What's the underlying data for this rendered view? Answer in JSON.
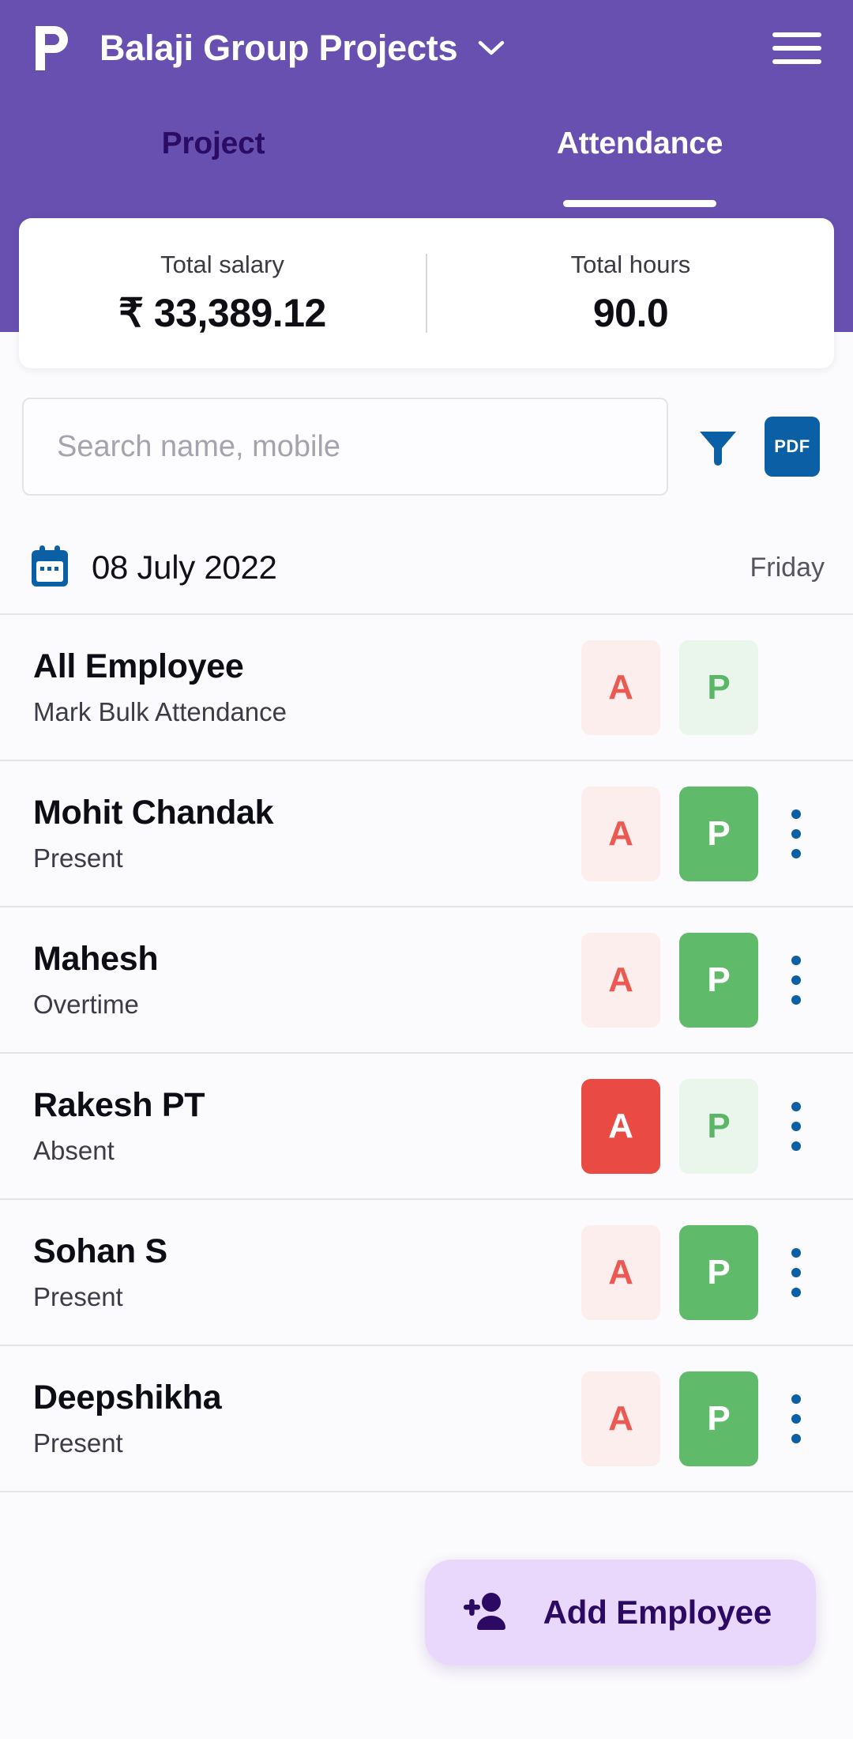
{
  "header": {
    "logo_icon": "p-logo-icon",
    "app_title": "Balaji Group Projects",
    "dropdown_icon": "chevron-down-icon",
    "menu_icon": "hamburger-menu-icon",
    "background_color": "#6750B0"
  },
  "tabs": [
    {
      "label": "Project",
      "active": false
    },
    {
      "label": "Attendance",
      "active": true
    }
  ],
  "stats": [
    {
      "label": "Total salary",
      "value": "₹ 33,389.12"
    },
    {
      "label": "Total hours",
      "value": "90.0"
    }
  ],
  "search": {
    "placeholder": "Search name, mobile",
    "value": "",
    "filter_icon": "filter-funnel-icon",
    "pdf_label": "PDF",
    "pdf_color": "#0a5fa5"
  },
  "date_bar": {
    "calendar_icon": "calendar-icon",
    "date": "08 July 2022",
    "day": "Friday"
  },
  "legend": {
    "absent_code": "A",
    "present_code": "P",
    "absent_color": "#e94b44",
    "present_color": "#5fbb6a"
  },
  "rows": [
    {
      "name": "All Employee",
      "status": "Mark Bulk Attendance",
      "absent_active": false,
      "present_active": false,
      "has_menu": false
    },
    {
      "name": "Mohit Chandak",
      "status": "Present",
      "absent_active": false,
      "present_active": true,
      "has_menu": true
    },
    {
      "name": "Mahesh",
      "status": "Overtime",
      "absent_active": false,
      "present_active": true,
      "has_menu": true
    },
    {
      "name": "Rakesh PT",
      "status": "Absent",
      "absent_active": true,
      "present_active": false,
      "has_menu": true
    },
    {
      "name": "Sohan S",
      "status": "Present",
      "absent_active": false,
      "present_active": true,
      "has_menu": true
    },
    {
      "name": "Deepshikha",
      "status": "Present",
      "absent_active": false,
      "present_active": true,
      "has_menu": true
    }
  ],
  "fab": {
    "icon": "person-add-icon",
    "label": "Add Employee",
    "background_color": "#e9d8fb",
    "text_color": "#2c0a63"
  }
}
